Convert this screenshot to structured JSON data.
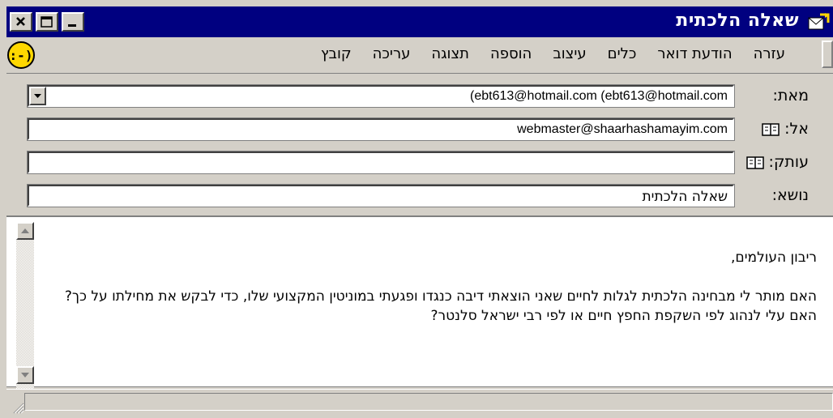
{
  "window": {
    "title": "שאלה הלכתית",
    "controls": [
      "minimize",
      "maximize",
      "close"
    ]
  },
  "menu": {
    "items": [
      "קובץ",
      "עריכה",
      "תצוגה",
      "הוספה",
      "עיצוב",
      "כלים",
      "הודעת דואר",
      "עזרה"
    ]
  },
  "toolbar": {
    "status_icon": "smiley-icon"
  },
  "header": {
    "from": {
      "label": "מאת:",
      "value": "(ebt613@hotmail.com   (ebt613@hotmail.com"
    },
    "to": {
      "label": "אל:",
      "value": "webmaster@shaarhashamayim.com"
    },
    "cc": {
      "label": "עותק:",
      "value": ""
    },
    "subject": {
      "label": "נושא:",
      "value": "שאלה הלכתית"
    }
  },
  "message": {
    "greeting": "ריבון העולמים,",
    "body": "האם מותר לי מבחינה הלכתית לגלות לחיים שאני הוצאתי דיבה כנגדו ופגעתי במוניטין המקצועי שלו, כדי לבקש את מחילתו על כך? האם עלי לנהוג לפי השקפת החפץ חיים או לפי רבי ישראל סלנטר?"
  },
  "colors": {
    "titlebar": "#000080",
    "face": "#d4d0c8",
    "field": "#ffffff"
  }
}
